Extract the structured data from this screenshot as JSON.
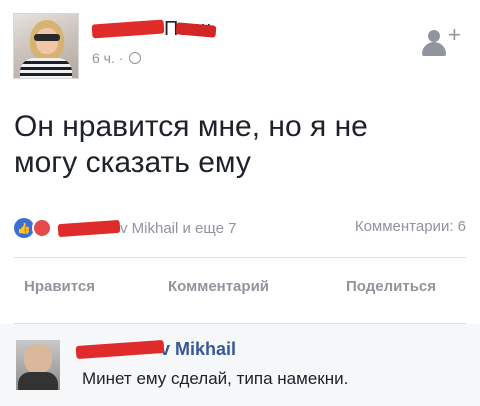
{
  "post": {
    "author_name_visible": "По       ш",
    "time": "6 ч. ·",
    "text_line1": "Он нравится мне, но я не",
    "text_line2": "могу сказать ему",
    "reactions_text": "v Mikhail и еще 7",
    "comments_count": "Комментарии: 6"
  },
  "actions": {
    "like": "Нравится",
    "comment": "Комментарий",
    "share": "Поделиться"
  },
  "comment": {
    "author_name_visible": "v Mikhail",
    "text": "Минет ему сделай, типа намекни."
  },
  "icons": [
    "add-friend-icon",
    "globe-icon",
    "like-reaction-icon",
    "love-reaction-icon"
  ],
  "colors": {
    "link_blue": "#365899",
    "muted_gray": "#90949c",
    "like_blue": "#3b6fd6",
    "redaction_red": "#e02b2b"
  }
}
